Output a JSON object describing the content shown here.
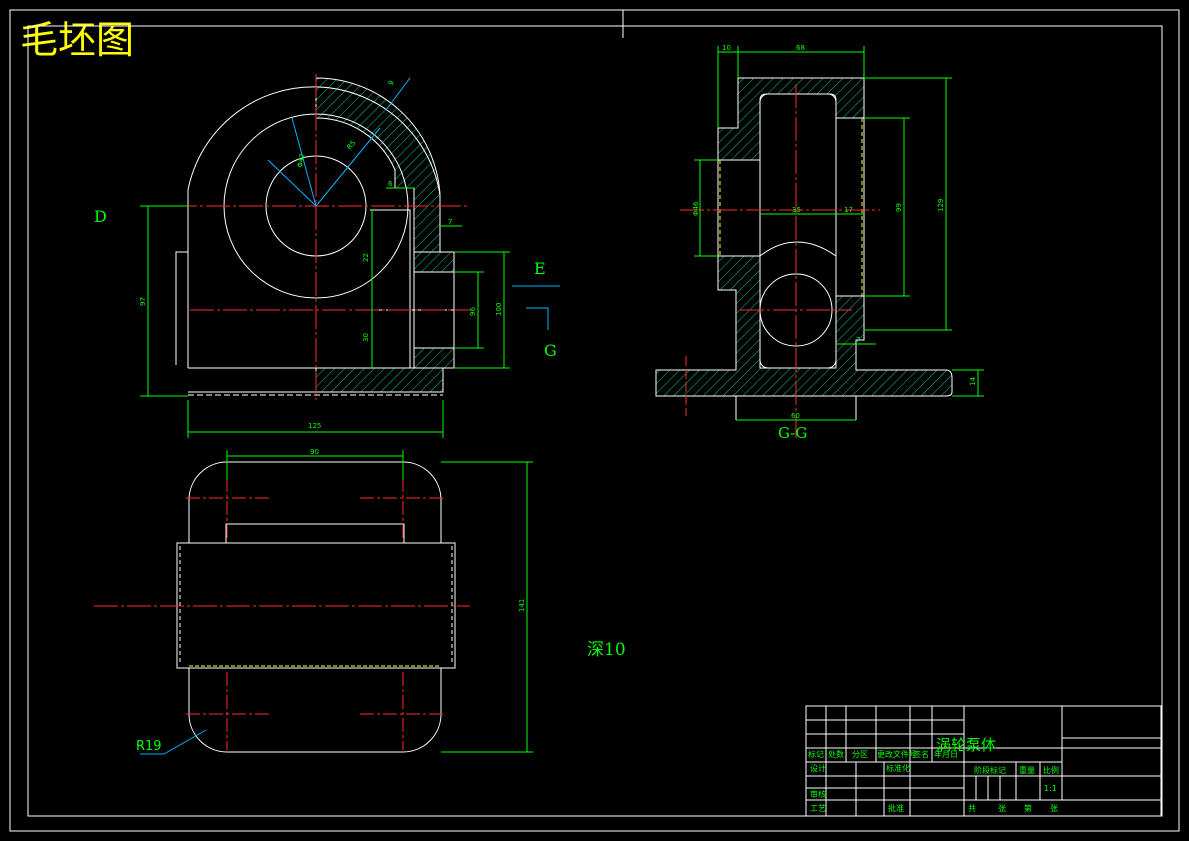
{
  "title": "毛坯图",
  "labels": {
    "d": "D",
    "e": "E",
    "g": "G",
    "section": "G-G",
    "depth": "深10",
    "radius": "R19"
  },
  "dims": {
    "top_d1": "10",
    "top_d2": "68",
    "front_9": "9",
    "front_r": "R5",
    "front_phi": "Φ42",
    "front_6": "6",
    "front_7": "7",
    "front_22": "22",
    "front_30": "30",
    "front_96": "96",
    "front_100": "100",
    "front_97": "97",
    "front_125": "125",
    "side_46": "Φ46",
    "side_35": "35",
    "side_17": "17",
    "side_99": "99",
    "side_129": "129",
    "side_7": "7",
    "side_14": "14",
    "side_60": "60",
    "plan_90": "90",
    "plan_141": "141"
  },
  "title_block": {
    "part_name": "涡轮泵体",
    "row_headers": [
      "标记",
      "处数",
      "分区",
      "更改文件号",
      "签名",
      "年月日"
    ],
    "design": "设计",
    "standard": "标准化",
    "stage_mark": "阶段标记",
    "weight": "重量",
    "scale": "比例",
    "scale_value": "1:1",
    "check": "审核",
    "process": "工艺",
    "approve": "批准",
    "sheets": [
      "共",
      "张",
      "第",
      "张"
    ]
  }
}
